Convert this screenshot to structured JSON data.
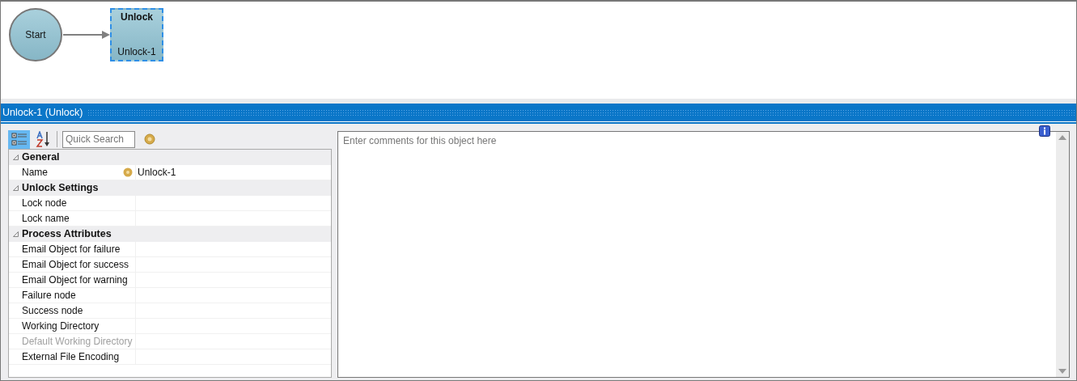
{
  "diagram": {
    "nodes": [
      {
        "kind": "start",
        "label": "Start",
        "selected": false
      },
      {
        "kind": "task",
        "title": "Unlock",
        "label": "Unlock-1",
        "selected": true
      }
    ]
  },
  "panel_title": "Unlock-1 (Unlock)",
  "properties": {
    "toolbar": [
      {
        "kind": "categorized",
        "selected": true
      },
      {
        "kind": "alphabetical",
        "selected": false
      }
    ],
    "search": {
      "placeholder": "Quick Search"
    },
    "categories": [
      {
        "name": "General",
        "expanded": true,
        "rows": [
          {
            "name": "Name",
            "value": "Unlock-1",
            "disabled": false,
            "flag": true
          }
        ]
      },
      {
        "name": "Unlock Settings",
        "expanded": true,
        "rows": [
          {
            "name": "Lock node",
            "disabled": false
          },
          {
            "name": "Lock name",
            "disabled": false
          }
        ]
      },
      {
        "name": "Process Attributes",
        "expanded": true,
        "rows": [
          {
            "name": "Email Object for failure",
            "disabled": false
          },
          {
            "name": "Email Object for success",
            "disabled": false
          },
          {
            "name": "Email Object for warning",
            "disabled": false
          },
          {
            "name": "Failure node",
            "disabled": false
          },
          {
            "name": "Success node",
            "disabled": false
          },
          {
            "name": "Working Directory",
            "disabled": false
          },
          {
            "name": "Default Working Directory",
            "disabled": true
          },
          {
            "name": "External File Encoding",
            "disabled": false
          }
        ]
      }
    ]
  },
  "comments": {
    "placeholder": "Enter comments for this object here"
  }
}
